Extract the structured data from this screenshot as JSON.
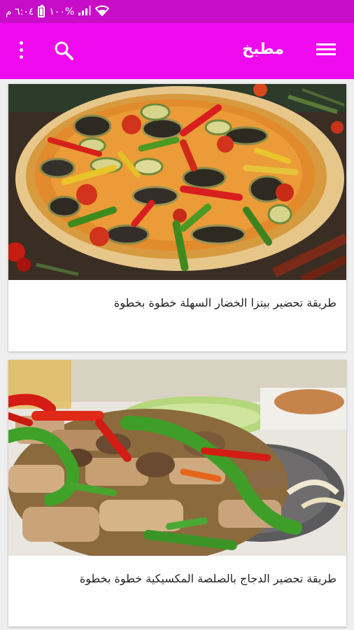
{
  "status_bar": {
    "time": "٦:٠٤ م",
    "battery": "١٠٠%"
  },
  "app_bar": {
    "title": "مطبخ",
    "menu_icon": "hamburger-menu-icon",
    "search_icon": "search-icon",
    "more_icon": "more-vert-icon"
  },
  "articles": [
    {
      "title": "طريقة تحضير بيتزا الخضار السهلة خطوة بخطوة",
      "image": "vegetable-pizza"
    },
    {
      "title": "طريقة تحضير الدجاج بالصلصة المكسيكية خطوة بخطوة",
      "image": "chicken-fajita"
    }
  ],
  "colors": {
    "status_bar": "#c70dc7",
    "app_bar": "#ef0aef",
    "background": "#efefef"
  }
}
